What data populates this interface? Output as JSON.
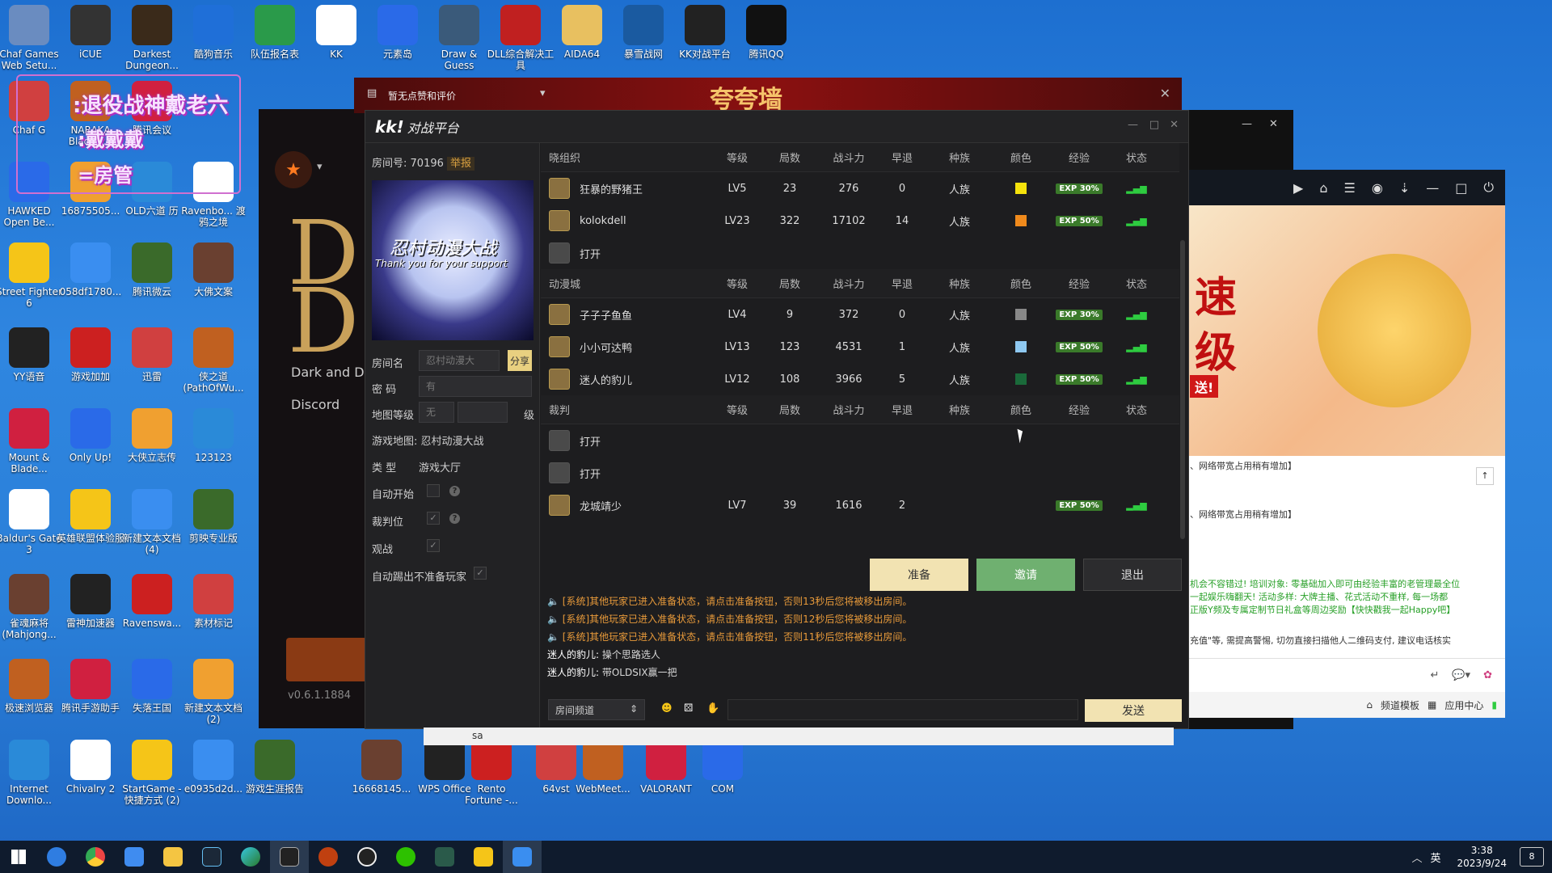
{
  "desktop": {
    "icons_row1": [
      "Chaf Games Web Setu...",
      "iCUE",
      "Darkest Dungeon...",
      "酷狗音乐",
      "队伍报名表",
      "KK",
      "元素岛",
      "Draw & Guess",
      "DLL综合解决工具",
      "AIDA64",
      "暴雪战网",
      "KK对战平台",
      "腾讯QQ"
    ],
    "icons_left": [
      "Chaf G",
      "NARAKA Blade P...",
      "腾讯会议",
      "HAWKED Open Be...",
      "16875505...",
      "OLD六道 历",
      "Ravenbo... 渡鸦之境",
      "Street Fighter 6",
      "058df1780...",
      "腾讯微云",
      "大佛文案",
      "YY语音",
      "游戏加加",
      "迅雷",
      "侠之道 (PathOfWu...",
      "Mount & Blade...",
      "Only Up!",
      "大侠立志传",
      "123123",
      "Baldur's Gate 3",
      "英雄联盟体验服",
      "新建文本文档 (4)",
      "剪映专业版",
      "雀魂麻将 (Mahjong...",
      "雷神加速器",
      "Ravenswa...",
      "素材标记",
      "极速浏览器",
      "腾讯手游助手",
      "失落王国",
      "新建文本文档 (2)",
      "Internet Downlo...",
      "Chivalry 2",
      "StartGame - 快捷方式 (2)",
      "e0935d2d...",
      "游戏生涯报告",
      "16668145...",
      "WPS Office",
      "Rento Fortune -...",
      "64vst",
      "WebMeet...",
      "VALORANT",
      "COM"
    ],
    "overlay_text": [
      ":退役战神戴老六",
      ":戴戴戴",
      "=房管"
    ]
  },
  "bg_window": {
    "title": "暂无点赞和评价",
    "banner": "夸夸墙",
    "game_title": "Dark and D",
    "discord": "Discord",
    "version": "v0.6.1.1884"
  },
  "kk": {
    "title": "对战平台",
    "logo": "kk!",
    "room_no_label": "房间号:",
    "room_no": "70196",
    "report": "举报",
    "room_image_title": "忍村动漫大战",
    "room_image_sub": "Thank you for your support",
    "room_name_label": "房间名",
    "room_name_value": "忍村动漫大",
    "share": "分享",
    "pwd_label": "密  码",
    "pwd_value": "有",
    "map_level_label": "地图等级",
    "map_level_value": "无",
    "level_unit": "级",
    "game_map_label": "游戏地图:",
    "game_map_value": "忍村动漫大战",
    "type_label": "类  型",
    "type_value": "游戏大厅",
    "auto_start": "自动开始",
    "referee_slot": "裁判位",
    "spectate": "观战",
    "auto_kick": "自动踢出不准备玩家",
    "columns": [
      "等级",
      "局数",
      "战斗力",
      "早退",
      "种族",
      "颜色",
      "经验",
      "状态"
    ],
    "teams": [
      {
        "name": "晓组织",
        "rows": [
          {
            "name": "狂暴的野猪王",
            "lv": "LV5",
            "games": "23",
            "power": "276",
            "quit": "0",
            "race": "人族",
            "color": "#f5e20c",
            "exp": "EXP 30%",
            "empty": false
          },
          {
            "name": "kolokdell",
            "lv": "LV23",
            "games": "322",
            "power": "17102",
            "quit": "14",
            "race": "人族",
            "color": "#f08a1c",
            "exp": "EXP 50%",
            "empty": false
          },
          {
            "name": "打开",
            "empty": true
          }
        ]
      },
      {
        "name": "动漫城",
        "rows": [
          {
            "name": "子子子鱼鱼",
            "lv": "LV4",
            "games": "9",
            "power": "372",
            "quit": "0",
            "race": "人族",
            "color": "#888888",
            "exp": "EXP 30%",
            "empty": false
          },
          {
            "name": "小小可达鸭",
            "lv": "LV13",
            "games": "123",
            "power": "4531",
            "quit": "1",
            "race": "人族",
            "color": "#8ec8f0",
            "exp": "EXP 50%",
            "empty": false
          },
          {
            "name": "迷人的豹儿",
            "lv": "LV12",
            "games": "108",
            "power": "3966",
            "quit": "5",
            "race": "人族",
            "color": "#1a6a3a",
            "exp": "EXP 50%",
            "empty": false
          }
        ]
      },
      {
        "name": "裁判",
        "rows": [
          {
            "name": "打开",
            "empty": true
          },
          {
            "name": "打开",
            "empty": true
          },
          {
            "name": "龙城靖少",
            "lv": "LV7",
            "games": "39",
            "power": "1616",
            "quit": "2",
            "race": "",
            "color": "",
            "exp": "EXP 50%",
            "empty": false
          }
        ]
      }
    ],
    "ready": "准备",
    "invite": "邀请",
    "exit": "退出",
    "messages": [
      {
        "text": "[系统]其他玩家已进入准备状态，请点击准备按钮，否则13秒后您将被移出房间。",
        "sys": true
      },
      {
        "text": "[系统]其他玩家已进入准备状态，请点击准备按钮，否则12秒后您将被移出房间。",
        "sys": true
      },
      {
        "text": "[系统]其他玩家已进入准备状态，请点击准备按钮，否则11秒后您将被移出房间。",
        "sys": true
      },
      {
        "who": "迷人的豹儿:",
        "text": "操个思路选人",
        "sys": false
      },
      {
        "who": "迷人的豹儿:",
        "text": "带OLDSIX赢一把",
        "sys": false
      }
    ],
    "channel": "房间频道",
    "send": "发送"
  },
  "yy": {
    "promo1": "速",
    "promo2": "级",
    "promo3": "送!",
    "line1": "、网络带宽占用稍有增加】",
    "line2": "、网络带宽占用稍有增加】",
    "green1": "机会不容错过! 培训对象: 零基础加入即可由经验丰富的老管理最全位",
    "green2": "一起娱乐嗨翻天! 活动多样: 大牌主播、花式活动不重样, 每一场都",
    "green3": "正版Y频及专属定制节日礼盒等周边奖励【快快戳我一起Happy吧】",
    "warn": "充值\"等, 需提高警惕, 切勿直接扫描他人二维码支付, 建议电话核实",
    "bottom1": "频道模板",
    "bottom2": "应用中心"
  },
  "taskbar": {
    "time": "3:38",
    "date": "2023/9/24",
    "ime": "英",
    "notif": "8"
  },
  "bottom_strip": {
    "text": "sa"
  }
}
